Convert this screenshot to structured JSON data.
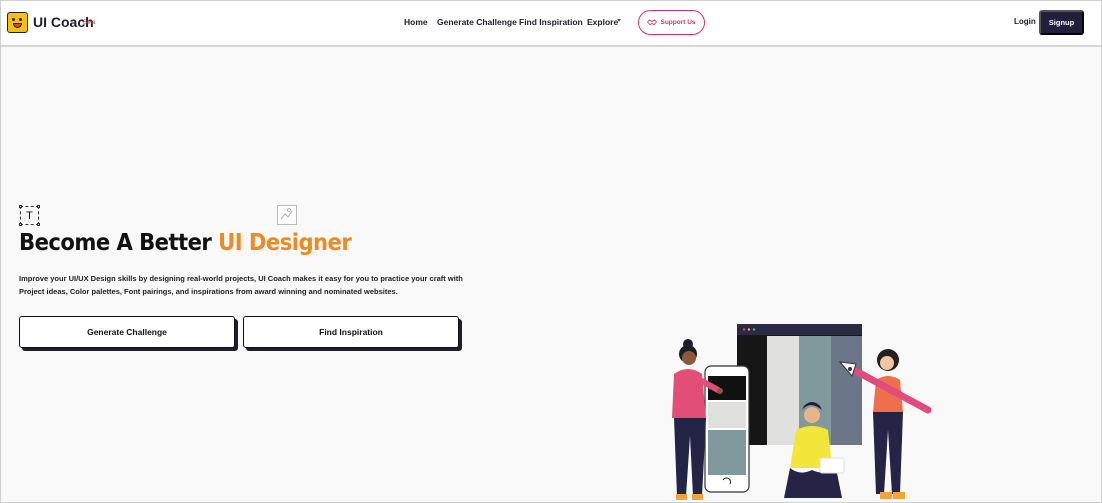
{
  "brand": {
    "name": "UI Coach",
    "badge": "Beta"
  },
  "nav": {
    "items": [
      "Home",
      "Generate Challenge",
      "Find Inspiration",
      "Explore"
    ],
    "support_label": "Support Us",
    "login_label": "Login",
    "signup_label": "Signup"
  },
  "hero": {
    "title_prefix": "Become A Better",
    "title_accent": "UI Designer",
    "description": "Improve your UI/UX Design skills by designing real-world projects, UI Coach makes it easy for you to practice your craft with Project ideas, Color palettes, Font pairings, and inspirations from award winning and nominated websites.",
    "buttons": [
      "Generate Challenge",
      "Find Inspiration"
    ],
    "text_icon_glyph": "T"
  },
  "colors": {
    "accent": "#ec8a23",
    "dark": "#221e3e",
    "support": "#d9345a",
    "logo": "#f4c10f",
    "palette": [
      "#e0e1de",
      "#7f999c",
      "#6b7788"
    ]
  }
}
